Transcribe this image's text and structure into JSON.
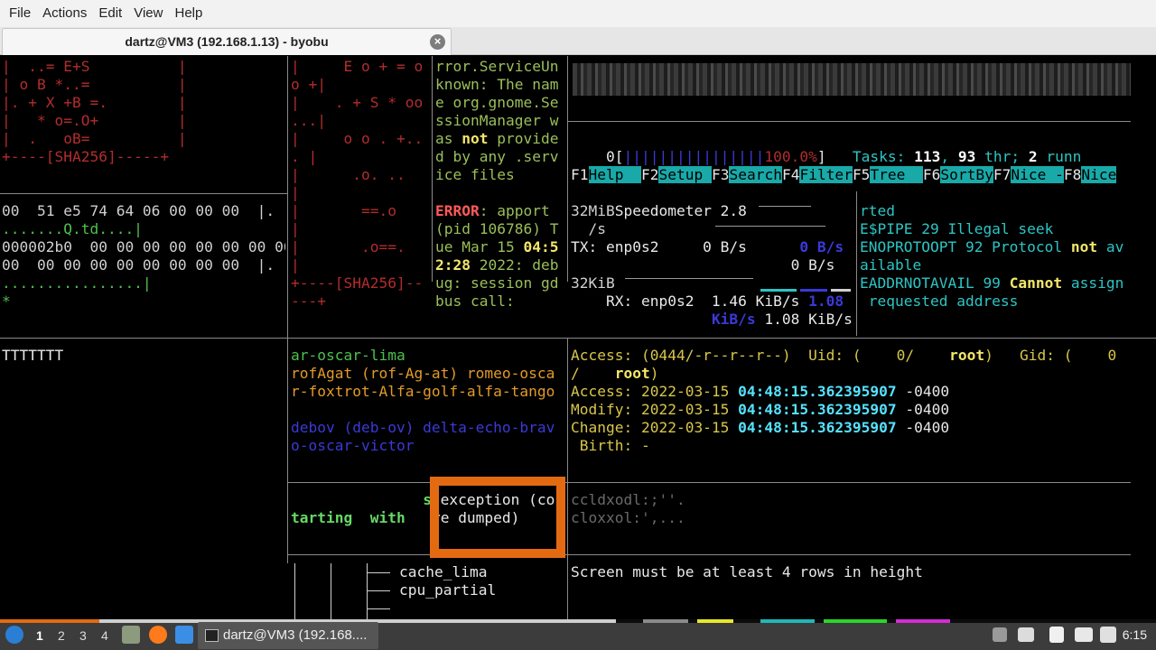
{
  "menu": [
    "File",
    "Actions",
    "Edit",
    "View",
    "Help"
  ],
  "tab": {
    "title": "dartz@VM3 (192.168.1.13) - byobu",
    "close": "×"
  },
  "panes": {
    "sha_art": [
      "|  ..= E+S          |",
      "| o B *..=          |",
      "|. + X +B =.        |",
      "|   * o=.O+         |",
      "|  .   oB=          |",
      "+----[SHA256]-----+"
    ],
    "hexdump": [
      "00  51 e5 74 64 06 00 00 00  |.",
      ".......Q.td....|",
      "000002b0  00 00 00 00 00 00 00 00",
      "00  00 00 00 00 00 00 00 00  |.",
      "................|",
      "*"
    ],
    "sha_art2": [
      "|     E o + = o",
      "o +|",
      "|    . + S * oo",
      "...|",
      "|     o o . +..",
      ". |",
      "|      .o. ..",
      "|",
      "|       ==.o",
      "|",
      "|       .o==.",
      "|",
      "+----[SHA256]--",
      "---+"
    ],
    "dbus_log": [
      "rror.ServiceUn",
      "known: The nam",
      "e org.gnome.Se",
      "ssionManager w",
      "as ",
      "not",
      " provide",
      "d by any .serv",
      "ice files",
      "",
      "ERROR",
      ": apport",
      "(pid 106786) T",
      "ue Mar 15 ",
      "04:5",
      "2:28",
      " 2022: deb",
      "ug: session gd",
      "bus call:"
    ],
    "htop": {
      "cpu_num": "0",
      "bar": "||||||||||||||||",
      "pct": "100.0%",
      "tasks_label": "Tasks: ",
      "tasks": "113",
      "thr": "93",
      "thr_label": " thr; ",
      "run": "2",
      "run_label": " runn",
      "fkeys": [
        [
          "F1",
          "Help  "
        ],
        [
          "F2",
          "Setup "
        ],
        [
          "F3",
          "Search"
        ],
        [
          "F4",
          "Filter"
        ],
        [
          "F5",
          "Tree  "
        ],
        [
          "F6",
          "SortBy"
        ],
        [
          "F7",
          "Nice -"
        ],
        [
          "F8",
          "Nice"
        ]
      ]
    },
    "speedometer": {
      "top": "32MiB",
      "per_s": "/s",
      "title": "Speedometer 2.8",
      "tx": "TX: enp0s2     0 B/s",
      "tx_val": "0 B/s",
      "tx_val2": "0 B/s",
      "mid": "32KiB",
      "rx": "RX: enp0s2  1.46 KiB/s ",
      "rx_val": "1.08",
      "rx_unit": "KiB/s",
      "rx_val2": " 1.08 KiB/s"
    },
    "errno": [
      "rted",
      "E$PIPE 29 Illegal seek",
      "ENOPROTOOPT 92 Protocol ",
      "not",
      " av",
      "ailable",
      "EADDRNOTAVAIL 99 ",
      "Cannot",
      " assign",
      " requested address"
    ],
    "blank_pane": "TTTTTTT",
    "phonetic": [
      "ar-oscar-lima",
      "rofAgat (rof-Ag-at) romeo-osca",
      "r-foxtrot-Alfa-golf-alfa-tango",
      "",
      "debov (deb-ov) delta-echo-brav",
      "o-oscar-victor"
    ],
    "stat": {
      "access_perm": "Access: (0444/-r--r--r--)  Uid: (    0/    ",
      "root_uid": "root",
      "gid_label": ")   Gid: (    0",
      "gid_line2": "/    ",
      "root_gid": "root",
      "close_paren": ")",
      "access_date": "Access: 2022-03-15 ",
      "access_time": "04:48:15.362395907",
      "tz": " -0400",
      "modify_date": "Modify: 2022-03-15 ",
      "modify_time": "04:48:15.362395907",
      "change_date": "Change: 2022-03-15 ",
      "change_time": "04:48:15.362395907",
      "birth": " Birth: -"
    },
    "starting": {
      "s": "s",
      "text": "tarting  with",
      "exc1": " exception (co",
      "exc2": "re dumped)"
    },
    "cclx": [
      "ccldxodl:;''.",
      "cloxxol:',..."
    ],
    "tree": [
      "cache_lima",
      "cpu_partial"
    ],
    "screen_msg": "Screen must be at least 4 rows in height"
  },
  "taskbar": {
    "workspaces": [
      "1",
      "2",
      "3",
      "4"
    ],
    "task_label": "dartz@VM3 (192.168....",
    "clock": "6:15"
  }
}
